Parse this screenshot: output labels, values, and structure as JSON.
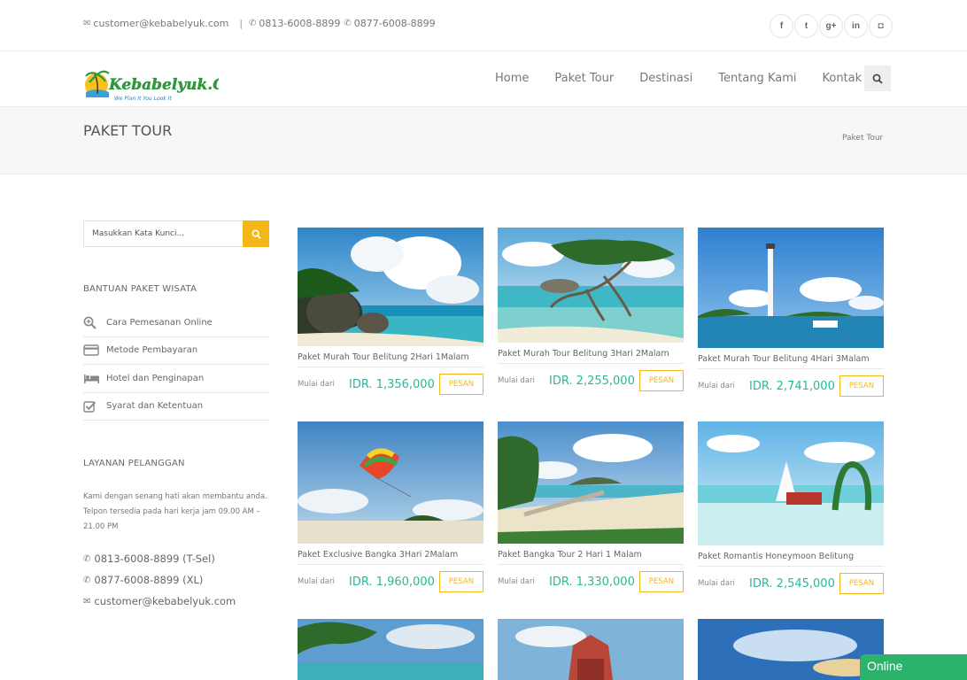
{
  "topbar": {
    "email": "customer@kebabelyuk.com",
    "phone1": "0813-6008-8899",
    "phone2": "0877-6008-8899",
    "social": [
      {
        "icon": "facebook-icon",
        "glyph": "f"
      },
      {
        "icon": "twitter-icon",
        "glyph": "t"
      },
      {
        "icon": "google-plus-icon",
        "glyph": "g+"
      },
      {
        "icon": "linkedin-icon",
        "glyph": "in"
      },
      {
        "icon": "instagram-icon",
        "glyph": "◘"
      }
    ]
  },
  "header": {
    "logo_text": "Kebabelyuk.Com",
    "logo_tagline": "We Plan It You Look It",
    "nav": [
      "Home",
      "Paket Tour",
      "Destinasi",
      "Tentang Kami",
      "Kontak"
    ]
  },
  "page": {
    "title": "PAKET TOUR",
    "breadcrumb": "Paket Tour"
  },
  "sidebar": {
    "search_placeholder": "Masukkan Kata Kunci...",
    "help_heading": "BANTUAN PAKET WISATA",
    "help_items": [
      {
        "icon": "search-plus-icon",
        "label": "Cara Pemesanan Online"
      },
      {
        "icon": "credit-card-icon",
        "label": "Metode Pembayaran"
      },
      {
        "icon": "bed-icon",
        "label": "Hotel dan Penginapan"
      },
      {
        "icon": "checkbox-icon",
        "label": "Syarat dan Ketentuan"
      }
    ],
    "service_heading": "LAYANAN PELANGGAN",
    "service_text": "Kami dengan senang hati akan membantu anda. Telpon tersedia pada hari kerja jam 09.00 AM – 21.00 PM",
    "service_phone1": "0813-6008-8899 (T-Sel)",
    "service_phone2": "0877-6008-8899 (XL)",
    "service_email": "customer@kebabelyuk.com"
  },
  "packages": [
    {
      "name": "Paket Murah Tour Belitung 2Hari 1Malam",
      "from": "Mulai dari",
      "price": "IDR. 1,356,000",
      "button": "PESAN"
    },
    {
      "name": "Paket Murah Tour Belitung 3Hari 2Malam",
      "from": "Mulai dari",
      "price": "IDR. 2,255,000",
      "button": "PESAN"
    },
    {
      "name": "Paket Murah Tour Belitung 4Hari 3Malam",
      "from": "Mulai dari",
      "price": "IDR. 2,741,000",
      "button": "PESAN"
    },
    {
      "name": "Paket Exclusive Bangka 3Hari 2Malam",
      "from": "Mulai dari",
      "price": "IDR. 1,960,000",
      "button": "PESAN"
    },
    {
      "name": "Paket Bangka Tour 2 Hari 1 Malam",
      "from": "Mulai dari",
      "price": "IDR. 1,330,000",
      "button": "PESAN"
    },
    {
      "name": "Paket Romantis Honeymoon Belitung",
      "from": "Mulai dari",
      "price": "IDR. 2,545,000",
      "button": "PESAN"
    }
  ],
  "chat": {
    "label": "Online"
  },
  "colors": {
    "accent_yellow": "#f5b717",
    "price_green": "#2ab79a",
    "chat_green": "#2bb36b"
  }
}
